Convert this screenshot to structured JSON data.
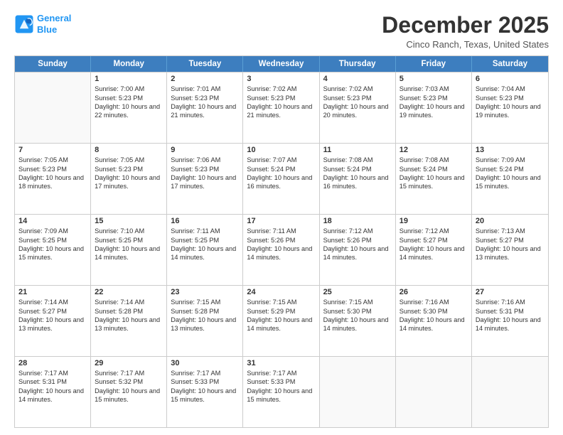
{
  "logo": {
    "line1": "General",
    "line2": "Blue"
  },
  "title": "December 2025",
  "location": "Cinco Ranch, Texas, United States",
  "days_of_week": [
    "Sunday",
    "Monday",
    "Tuesday",
    "Wednesday",
    "Thursday",
    "Friday",
    "Saturday"
  ],
  "weeks": [
    [
      {
        "day": "",
        "sunrise": "",
        "sunset": "",
        "daylight": ""
      },
      {
        "day": "1",
        "sunrise": "Sunrise: 7:00 AM",
        "sunset": "Sunset: 5:23 PM",
        "daylight": "Daylight: 10 hours and 22 minutes."
      },
      {
        "day": "2",
        "sunrise": "Sunrise: 7:01 AM",
        "sunset": "Sunset: 5:23 PM",
        "daylight": "Daylight: 10 hours and 21 minutes."
      },
      {
        "day": "3",
        "sunrise": "Sunrise: 7:02 AM",
        "sunset": "Sunset: 5:23 PM",
        "daylight": "Daylight: 10 hours and 21 minutes."
      },
      {
        "day": "4",
        "sunrise": "Sunrise: 7:02 AM",
        "sunset": "Sunset: 5:23 PM",
        "daylight": "Daylight: 10 hours and 20 minutes."
      },
      {
        "day": "5",
        "sunrise": "Sunrise: 7:03 AM",
        "sunset": "Sunset: 5:23 PM",
        "daylight": "Daylight: 10 hours and 19 minutes."
      },
      {
        "day": "6",
        "sunrise": "Sunrise: 7:04 AM",
        "sunset": "Sunset: 5:23 PM",
        "daylight": "Daylight: 10 hours and 19 minutes."
      }
    ],
    [
      {
        "day": "7",
        "sunrise": "Sunrise: 7:05 AM",
        "sunset": "Sunset: 5:23 PM",
        "daylight": "Daylight: 10 hours and 18 minutes."
      },
      {
        "day": "8",
        "sunrise": "Sunrise: 7:05 AM",
        "sunset": "Sunset: 5:23 PM",
        "daylight": "Daylight: 10 hours and 17 minutes."
      },
      {
        "day": "9",
        "sunrise": "Sunrise: 7:06 AM",
        "sunset": "Sunset: 5:23 PM",
        "daylight": "Daylight: 10 hours and 17 minutes."
      },
      {
        "day": "10",
        "sunrise": "Sunrise: 7:07 AM",
        "sunset": "Sunset: 5:24 PM",
        "daylight": "Daylight: 10 hours and 16 minutes."
      },
      {
        "day": "11",
        "sunrise": "Sunrise: 7:08 AM",
        "sunset": "Sunset: 5:24 PM",
        "daylight": "Daylight: 10 hours and 16 minutes."
      },
      {
        "day": "12",
        "sunrise": "Sunrise: 7:08 AM",
        "sunset": "Sunset: 5:24 PM",
        "daylight": "Daylight: 10 hours and 15 minutes."
      },
      {
        "day": "13",
        "sunrise": "Sunrise: 7:09 AM",
        "sunset": "Sunset: 5:24 PM",
        "daylight": "Daylight: 10 hours and 15 minutes."
      }
    ],
    [
      {
        "day": "14",
        "sunrise": "Sunrise: 7:09 AM",
        "sunset": "Sunset: 5:25 PM",
        "daylight": "Daylight: 10 hours and 15 minutes."
      },
      {
        "day": "15",
        "sunrise": "Sunrise: 7:10 AM",
        "sunset": "Sunset: 5:25 PM",
        "daylight": "Daylight: 10 hours and 14 minutes."
      },
      {
        "day": "16",
        "sunrise": "Sunrise: 7:11 AM",
        "sunset": "Sunset: 5:25 PM",
        "daylight": "Daylight: 10 hours and 14 minutes."
      },
      {
        "day": "17",
        "sunrise": "Sunrise: 7:11 AM",
        "sunset": "Sunset: 5:26 PM",
        "daylight": "Daylight: 10 hours and 14 minutes."
      },
      {
        "day": "18",
        "sunrise": "Sunrise: 7:12 AM",
        "sunset": "Sunset: 5:26 PM",
        "daylight": "Daylight: 10 hours and 14 minutes."
      },
      {
        "day": "19",
        "sunrise": "Sunrise: 7:12 AM",
        "sunset": "Sunset: 5:27 PM",
        "daylight": "Daylight: 10 hours and 14 minutes."
      },
      {
        "day": "20",
        "sunrise": "Sunrise: 7:13 AM",
        "sunset": "Sunset: 5:27 PM",
        "daylight": "Daylight: 10 hours and 13 minutes."
      }
    ],
    [
      {
        "day": "21",
        "sunrise": "Sunrise: 7:14 AM",
        "sunset": "Sunset: 5:27 PM",
        "daylight": "Daylight: 10 hours and 13 minutes."
      },
      {
        "day": "22",
        "sunrise": "Sunrise: 7:14 AM",
        "sunset": "Sunset: 5:28 PM",
        "daylight": "Daylight: 10 hours and 13 minutes."
      },
      {
        "day": "23",
        "sunrise": "Sunrise: 7:15 AM",
        "sunset": "Sunset: 5:28 PM",
        "daylight": "Daylight: 10 hours and 13 minutes."
      },
      {
        "day": "24",
        "sunrise": "Sunrise: 7:15 AM",
        "sunset": "Sunset: 5:29 PM",
        "daylight": "Daylight: 10 hours and 14 minutes."
      },
      {
        "day": "25",
        "sunrise": "Sunrise: 7:15 AM",
        "sunset": "Sunset: 5:30 PM",
        "daylight": "Daylight: 10 hours and 14 minutes."
      },
      {
        "day": "26",
        "sunrise": "Sunrise: 7:16 AM",
        "sunset": "Sunset: 5:30 PM",
        "daylight": "Daylight: 10 hours and 14 minutes."
      },
      {
        "day": "27",
        "sunrise": "Sunrise: 7:16 AM",
        "sunset": "Sunset: 5:31 PM",
        "daylight": "Daylight: 10 hours and 14 minutes."
      }
    ],
    [
      {
        "day": "28",
        "sunrise": "Sunrise: 7:17 AM",
        "sunset": "Sunset: 5:31 PM",
        "daylight": "Daylight: 10 hours and 14 minutes."
      },
      {
        "day": "29",
        "sunrise": "Sunrise: 7:17 AM",
        "sunset": "Sunset: 5:32 PM",
        "daylight": "Daylight: 10 hours and 15 minutes."
      },
      {
        "day": "30",
        "sunrise": "Sunrise: 7:17 AM",
        "sunset": "Sunset: 5:33 PM",
        "daylight": "Daylight: 10 hours and 15 minutes."
      },
      {
        "day": "31",
        "sunrise": "Sunrise: 7:17 AM",
        "sunset": "Sunset: 5:33 PM",
        "daylight": "Daylight: 10 hours and 15 minutes."
      },
      {
        "day": "",
        "sunrise": "",
        "sunset": "",
        "daylight": ""
      },
      {
        "day": "",
        "sunrise": "",
        "sunset": "",
        "daylight": ""
      },
      {
        "day": "",
        "sunrise": "",
        "sunset": "",
        "daylight": ""
      }
    ]
  ]
}
